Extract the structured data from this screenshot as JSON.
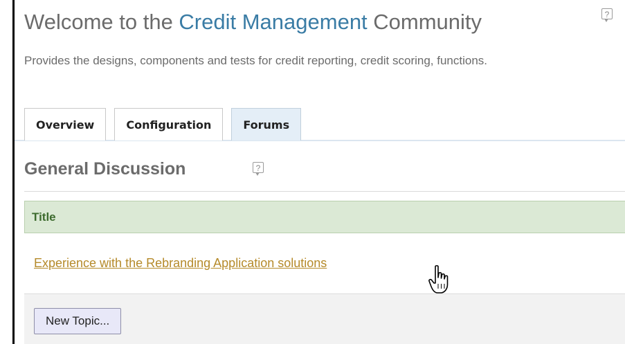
{
  "header": {
    "title_prefix": "Welcome to the ",
    "title_accent": "Credit Management",
    "title_suffix": " Community",
    "description": "Provides the designs, components and tests for credit reporting, credit scoring, functions."
  },
  "tabs": [
    {
      "label": "Overview",
      "active": false
    },
    {
      "label": "Configuration",
      "active": false
    },
    {
      "label": "Forums",
      "active": true
    }
  ],
  "section": {
    "title": "General Discussion"
  },
  "table": {
    "column_header": "Title",
    "rows": [
      {
        "title": "Experience with the Rebranding Application solutions"
      }
    ]
  },
  "actions": {
    "new_topic_label": "New Topic..."
  },
  "icons": {
    "help": "?"
  },
  "colors": {
    "accent": "#3a7ca5",
    "link": "#b58a2a",
    "header_green_bg": "#dbe9d5",
    "header_green_text": "#3d6b2e",
    "active_tab_bg": "#e4eef7"
  }
}
